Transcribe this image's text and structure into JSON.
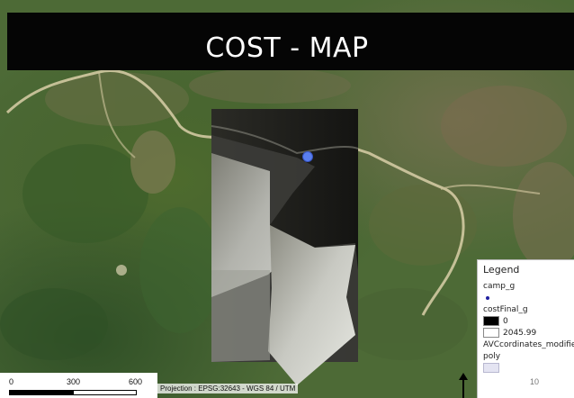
{
  "title": "COST - MAP",
  "legend": {
    "title": "Legend",
    "layer1": "camp_g",
    "layer2": "costFinal_g",
    "value_low": "0",
    "value_high": "2045.99",
    "layer3": "AVCcordinates_modified",
    "layer3_type": "poly"
  },
  "page_number": "10",
  "scale": {
    "label_0": "0",
    "label_1": "300",
    "label_2": "600"
  },
  "projection": "Projection : EPSG:32643 - WGS 84 / UTM",
  "colors": {
    "title_band": "#050505",
    "camp_point": "#5a7ff0",
    "cost_low": "#000000",
    "cost_high": "#ffffff",
    "poly_fill": "#e4e4f2"
  }
}
